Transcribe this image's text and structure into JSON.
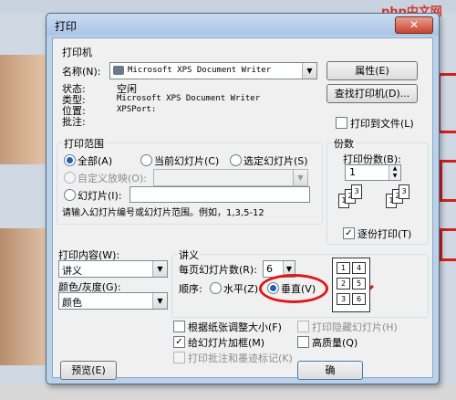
{
  "dialog": {
    "title": "打印",
    "close": "✕"
  },
  "watermark": "php中文网",
  "printer": {
    "group_title": "打印机",
    "name_label": "名称(N):",
    "name_value": "Microsoft XPS Document Writer",
    "properties_button": "属性(E)",
    "find_printer_button": "查找打印机(D)...",
    "status_label": "状态:",
    "status_value": "空闲",
    "type_label": "类型:",
    "type_value": "Microsoft XPS Document Writer",
    "location_label": "位置:",
    "location_value": "XPSPort:",
    "comment_label": "批注:",
    "comment_value": "",
    "print_to_file": "打印到文件(L)"
  },
  "range": {
    "group_title": "打印范围",
    "all": "全部(A)",
    "current_slide": "当前幻灯片(C)",
    "selection": "选定幻灯片(S)",
    "custom_show": "自定义放映(O):",
    "slides": "幻灯片(I):",
    "slides_value": "",
    "hint": "请输入幻灯片编号或幻灯片范围。例如，1,3,5-12"
  },
  "copies": {
    "group_title": "份数",
    "count_label": "打印份数(B):",
    "count_value": "1",
    "collate": "逐份打印(T)",
    "collate_checked": true
  },
  "print_what": {
    "label": "打印内容(W):",
    "value": "讲义",
    "color_label": "颜色/灰度(G):",
    "color_value": "颜色"
  },
  "handouts": {
    "group_title": "讲义",
    "per_page_label": "每页幻灯片数(R):",
    "per_page_value": "6",
    "order_label": "顺序:",
    "horizontal": "水平(Z)",
    "vertical": "垂直(V)",
    "selected": "vertical",
    "preview_slots": [
      "1",
      "4",
      "2",
      "5",
      "3",
      "6"
    ]
  },
  "options": {
    "scale_to_fit": "根据纸张调整大小(F)",
    "frame_slides": "给幻灯片加框(M)",
    "print_comments": "打印批注和墨迹标记(K)",
    "print_hidden": "打印隐藏幻灯片(H)",
    "high_quality": "高质量(Q)",
    "frame_checked": true
  },
  "buttons": {
    "preview": "预览(E)",
    "ok": "确"
  }
}
